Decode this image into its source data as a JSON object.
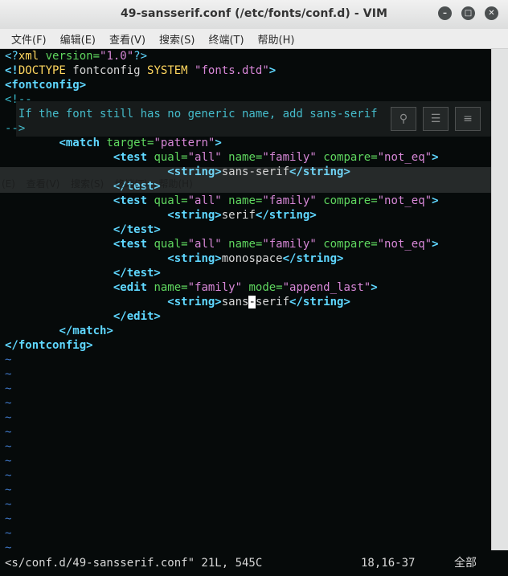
{
  "window": {
    "title": "49-sansserif.conf (/etc/fonts/conf.d) - VIM"
  },
  "menu": [
    "文件(F)",
    "编辑(E)",
    "查看(V)",
    "搜索(S)",
    "终端(T)",
    "帮助(H)"
  ],
  "ghost_menu": "(E) 查看(V) 搜索(S) 终端(T) 帮助(H)",
  "editor": {
    "l1": [
      "<?",
      "xml",
      " version=",
      "\"1.0\"",
      "?>"
    ],
    "l2": [
      "<!",
      "DOCTYPE",
      " fontconfig ",
      "SYSTEM",
      " ",
      "\"fonts.dtd\"",
      ">"
    ],
    "l3": "<fontconfig>",
    "l4": "<!--",
    "l5": "  If the font still has no generic name, add sans-serif",
    "l6": "-->",
    "match_open": {
      "tag": "<match",
      "attr": " target=",
      "val": "\"pattern\"",
      "close": ">"
    },
    "test_tag": "<test",
    "qual_attr": " qual=",
    "qual_val": "\"all\"",
    "name_attr": " name=",
    "family_val": "\"family\"",
    "compare_attr": " compare=",
    "compare_val": "\"not_eq\"",
    "close_angle": ">",
    "string_open": "<string>",
    "string_close": "</string>",
    "test_close": "</test>",
    "s1": "sans-serif",
    "s2": "serif",
    "s3": "monospace",
    "edit_tag": "<edit",
    "mode_attr": " mode=",
    "mode_val": "\"append_last\"",
    "s4a": "sans",
    "s4cursor": "-",
    "s4b": "serif",
    "edit_close": "</edit>",
    "match_close": "</match>",
    "fontconfig_close": "</fontconfig>",
    "tilde": "~"
  },
  "status": {
    "file": "<s/conf.d/49-sansserif.conf\" 21L, 545C",
    "position": "18,16-37",
    "percent": "全部"
  },
  "icons": {
    "minimize": "minimize-icon",
    "maximize": "maximize-icon",
    "close": "close-icon"
  }
}
